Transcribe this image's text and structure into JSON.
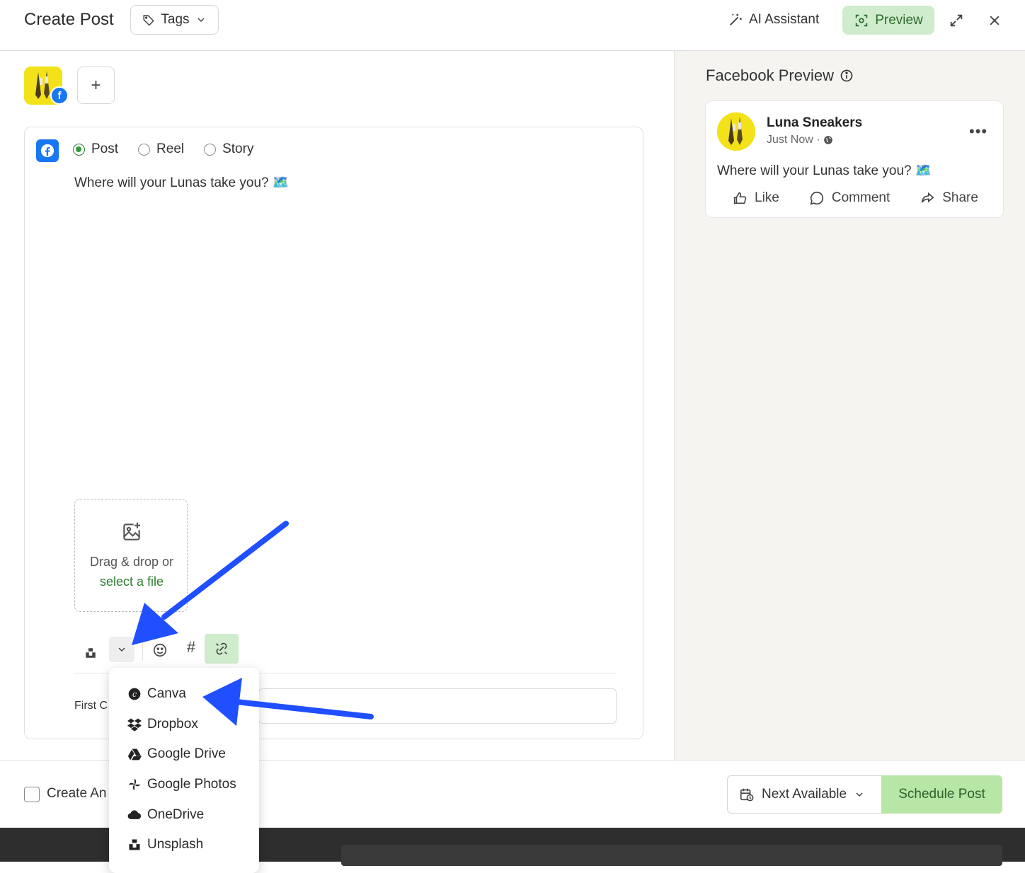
{
  "header": {
    "title": "Create Post",
    "tags_label": "Tags",
    "ai_assistant_label": "AI Assistant",
    "preview_label": "Preview"
  },
  "composer": {
    "post_types": [
      {
        "label": "Post",
        "selected": true
      },
      {
        "label": "Reel",
        "selected": false
      },
      {
        "label": "Story",
        "selected": false
      }
    ],
    "post_text": "Where will your Lunas take you? 🗺️",
    "dropzone_text": "Drag & drop or",
    "dropzone_link": "select a file",
    "first_comment_label": "First C"
  },
  "upload_menu": {
    "items": [
      {
        "label": "Canva",
        "icon": "canva-icon"
      },
      {
        "label": "Dropbox",
        "icon": "dropbox-icon"
      },
      {
        "label": "Google Drive",
        "icon": "google-drive-icon"
      },
      {
        "label": "Google Photos",
        "icon": "google-photos-icon"
      },
      {
        "label": "OneDrive",
        "icon": "onedrive-icon"
      },
      {
        "label": "Unsplash",
        "icon": "unsplash-icon"
      }
    ]
  },
  "preview": {
    "title": "Facebook Preview",
    "page_name": "Luna Sneakers",
    "time": "Just Now ·",
    "text": "Where will your Lunas take you? 🗺️",
    "actions": {
      "like": "Like",
      "comment": "Comment",
      "share": "Share"
    }
  },
  "footer": {
    "checkbox_label": "Create An",
    "next_available_label": "Next Available",
    "schedule_label": "Schedule Post"
  },
  "colors": {
    "accent_green": "#cfeccd",
    "schedule_green": "#b7e6a6",
    "facebook_blue": "#1877f2",
    "arrow_blue": "#1f4fff"
  }
}
